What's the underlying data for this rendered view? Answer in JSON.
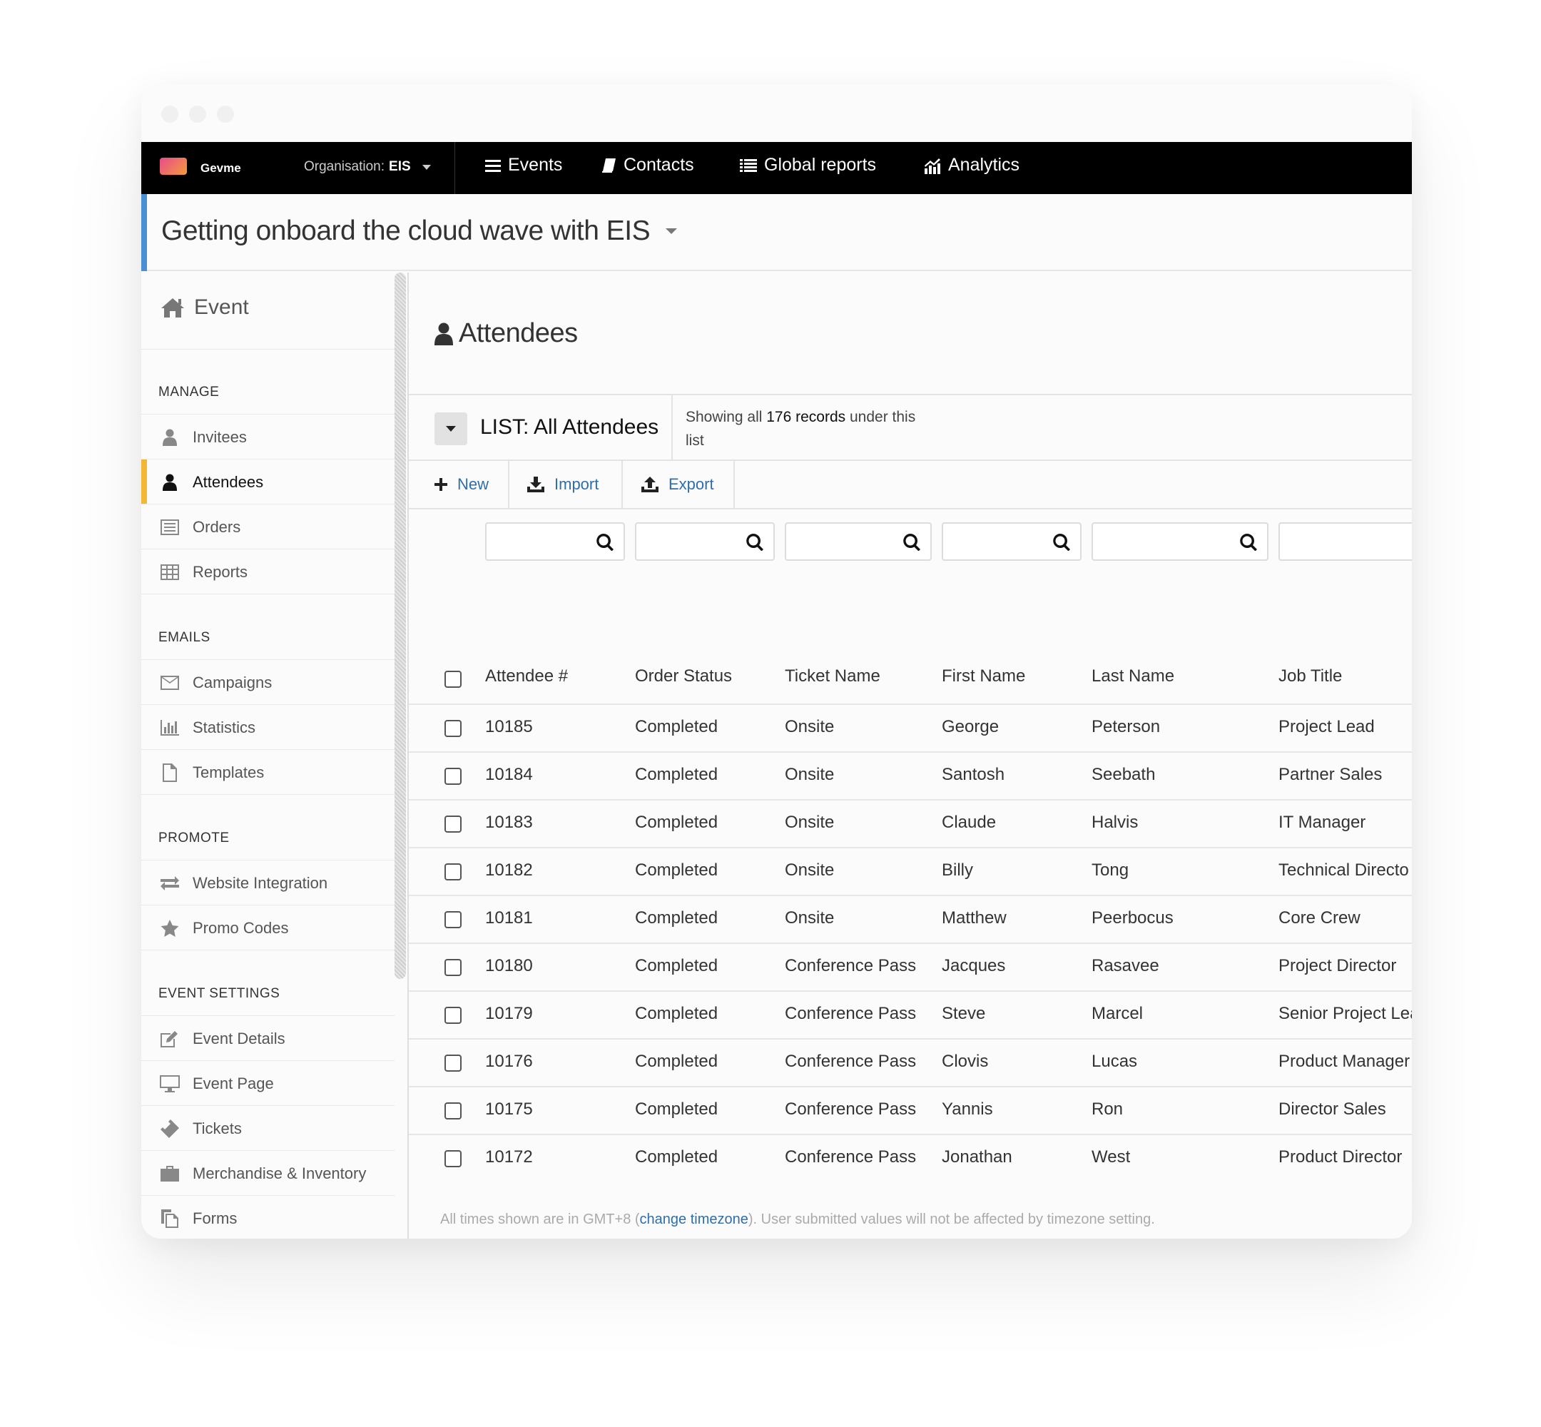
{
  "app": {
    "brand": "Gevme",
    "org_label": "Organisation:",
    "org_value": "EIS"
  },
  "nav": {
    "events": "Events",
    "contacts": "Contacts",
    "global_reports": "Global reports",
    "analytics": "Analytics"
  },
  "event_title": "Getting onboard the cloud wave with EIS",
  "sidebar": {
    "event_label": "Event",
    "sections": {
      "manage": "MANAGE",
      "emails": "EMAILS",
      "promote": "PROMOTE",
      "event_settings": "EVENT SETTINGS"
    },
    "items": {
      "invitees": "Invitees",
      "attendees": "Attendees",
      "orders": "Orders",
      "reports": "Reports",
      "campaigns": "Campaigns",
      "statistics": "Statistics",
      "templates": "Templates",
      "website_integration": "Website Integration",
      "promo_codes": "Promo Codes",
      "event_details": "Event Details",
      "event_page": "Event Page",
      "tickets": "Tickets",
      "merchandise": "Merchandise & Inventory",
      "forms": "Forms"
    }
  },
  "page": {
    "title": "Attendees",
    "list_name": "LIST: All Attendees",
    "info_prefix": "Showing all ",
    "info_count": "176 records",
    "info_suffix": " under this list",
    "actions": {
      "new": "New",
      "import": "Import",
      "export": "Export"
    }
  },
  "table": {
    "headers": {
      "attendee": "Attendee #",
      "order_status": "Order Status",
      "ticket_name": "Ticket Name",
      "first_name": "First Name",
      "last_name": "Last Name",
      "job_title": "Job Title"
    },
    "rows": [
      {
        "id": "10185",
        "status": "Completed",
        "ticket": "Onsite",
        "first": "George",
        "last": "Peterson",
        "job": "Project Lead"
      },
      {
        "id": "10184",
        "status": "Completed",
        "ticket": "Onsite",
        "first": "Santosh",
        "last": "Seebath",
        "job": "Partner Sales"
      },
      {
        "id": "10183",
        "status": "Completed",
        "ticket": "Onsite",
        "first": "Claude",
        "last": "Halvis",
        "job": "IT Manager"
      },
      {
        "id": "10182",
        "status": "Completed",
        "ticket": "Onsite",
        "first": "Billy",
        "last": "Tong",
        "job": "Technical Directo"
      },
      {
        "id": "10181",
        "status": "Completed",
        "ticket": "Onsite",
        "first": "Matthew",
        "last": "Peerbocus",
        "job": "Core Crew"
      },
      {
        "id": "10180",
        "status": "Completed",
        "ticket": "Conference Pass",
        "first": "Jacques",
        "last": "Rasavee",
        "job": "Project Director"
      },
      {
        "id": "10179",
        "status": "Completed",
        "ticket": "Conference Pass",
        "first": "Steve",
        "last": "Marcel",
        "job": "Senior Project Lea"
      },
      {
        "id": "10176",
        "status": "Completed",
        "ticket": "Conference Pass",
        "first": "Clovis",
        "last": "Lucas",
        "job": "Product Manager"
      },
      {
        "id": "10175",
        "status": "Completed",
        "ticket": "Conference Pass",
        "first": "Yannis",
        "last": "Ron",
        "job": "Director Sales"
      },
      {
        "id": "10172",
        "status": "Completed",
        "ticket": "Conference Pass",
        "first": "Jonathan",
        "last": "West",
        "job": "Product Director"
      }
    ]
  },
  "footnote": {
    "prefix": "All times shown are in GMT+8 (",
    "link": "change timezone",
    "suffix": "). User submitted values will not be affected by timezone setting."
  },
  "colors": {
    "navbar": "#000000",
    "event_accent": "#4a8fd1",
    "active_accent": "#f1b735",
    "link": "#2f6ea9"
  }
}
